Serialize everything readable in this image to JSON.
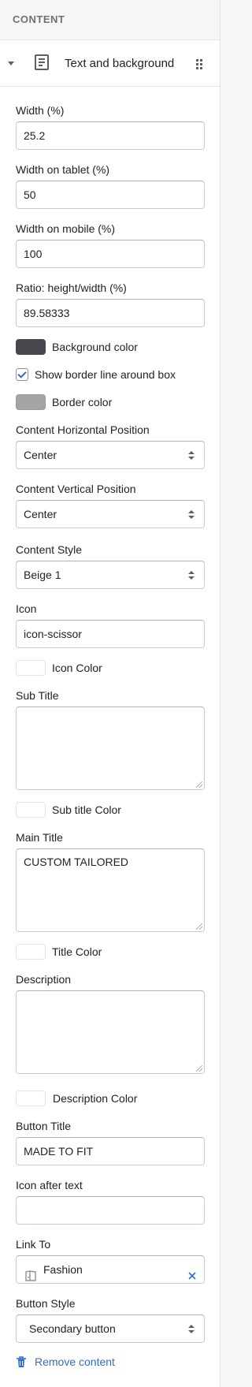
{
  "section": {
    "title": "CONTENT"
  },
  "block": {
    "label": "Text and background"
  },
  "fields": {
    "width": {
      "label": "Width (%)",
      "value": "25.2"
    },
    "width_tablet": {
      "label": "Width on tablet (%)",
      "value": "50"
    },
    "width_mobile": {
      "label": "Width on mobile (%)",
      "value": "100"
    },
    "ratio": {
      "label": "Ratio: height/width (%)",
      "value": "89.58333"
    },
    "background_color": {
      "label": "Background color",
      "color": "#45474c"
    },
    "show_border": {
      "label": "Show border line around box",
      "checked": true
    },
    "border_color": {
      "label": "Border color",
      "color": "#a4a4a6"
    },
    "content_h_pos": {
      "label": "Content Horizontal Position",
      "value": "Center"
    },
    "content_v_pos": {
      "label": "Content Vertical Position",
      "value": "Center"
    },
    "content_style": {
      "label": "Content Style",
      "value": "Beige 1"
    },
    "icon": {
      "label": "Icon",
      "value": "icon-scissor"
    },
    "icon_color": {
      "label": "Icon Color",
      "color": "#ffffff"
    },
    "sub_title": {
      "label": "Sub Title",
      "value": ""
    },
    "sub_title_color": {
      "label": "Sub title Color",
      "color": "#ffffff"
    },
    "main_title": {
      "label": "Main Title",
      "value": "CUSTOM TAILORED"
    },
    "title_color": {
      "label": "Title Color",
      "color": "#ffffff"
    },
    "description": {
      "label": "Description",
      "value": ""
    },
    "description_color": {
      "label": "Description Color",
      "color": "#ffffff"
    },
    "button_title": {
      "label": "Button Title",
      "value": "MADE TO FIT"
    },
    "icon_after_text": {
      "label": "Icon after text",
      "value": ""
    },
    "link_to": {
      "label": "Link To",
      "value": "Fashion",
      "icon": "collection-icon"
    },
    "button_style": {
      "label": "Button Style",
      "value": "Secondary button"
    }
  },
  "actions": {
    "remove_label": "Remove content"
  },
  "colors": {
    "accent": "#2c6ecb",
    "border": "#c9cccf",
    "header_bg": "#f6f6f7"
  }
}
